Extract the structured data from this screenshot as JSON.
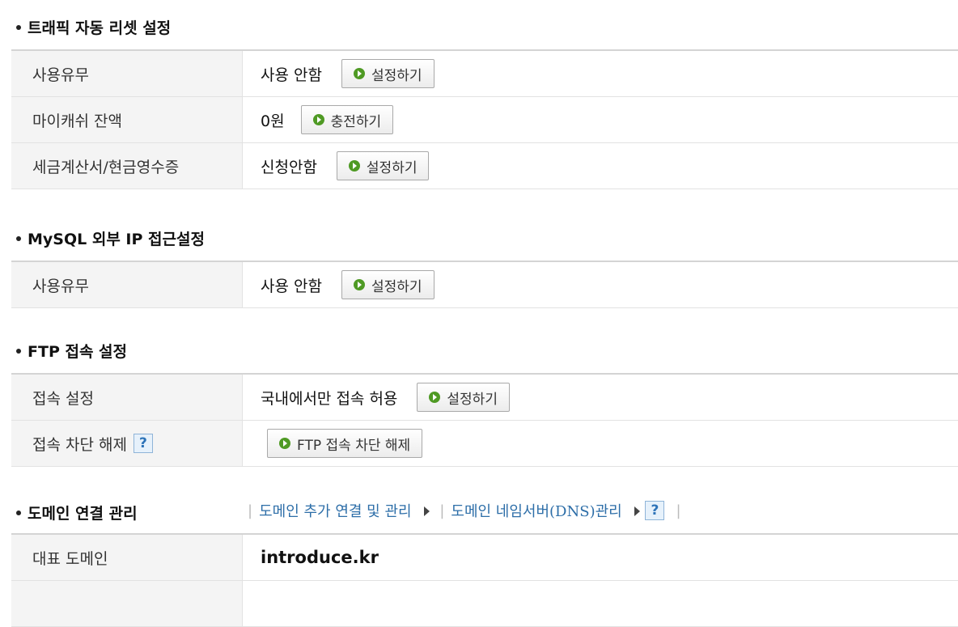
{
  "traffic": {
    "title": "트래픽 자동 리셋 설정",
    "rows": [
      {
        "label": "사용유무",
        "value": "사용 안함",
        "button": "설정하기"
      },
      {
        "label": "마이캐쉬 잔액",
        "value": "0원",
        "button": "충전하기"
      },
      {
        "label": "세금계산서/현금영수증",
        "value": "신청안함",
        "button": "설정하기"
      }
    ]
  },
  "mysql": {
    "title": "MySQL 외부 IP 접근설정",
    "rows": [
      {
        "label": "사용유무",
        "value": "사용 안함",
        "button": "설정하기"
      }
    ]
  },
  "ftp": {
    "title": "FTP 접속 설정",
    "rows": [
      {
        "label": "접속 설정",
        "value": "국내에서만 접속 허용",
        "button": "설정하기"
      },
      {
        "label": "접속 차단 해제",
        "help": "?",
        "button": "FTP 접속 차단 해제"
      }
    ]
  },
  "domain": {
    "title": "도메인 연결 관리",
    "links": [
      "도메인 추가 연결 및 관리",
      "도메인 네임서버(DNS)관리"
    ],
    "help": "?",
    "rows": [
      {
        "label": "대표 도메인",
        "value": "introduce.kr"
      }
    ]
  },
  "icons": {
    "button_icon": "green-circle-arrow-icon",
    "link_arrow": "triangle-right-icon",
    "help": "question-icon"
  },
  "colors": {
    "label_bg": "#f4f4f4",
    "link": "#2d6ea8",
    "button_icon": "#4f9a24"
  }
}
